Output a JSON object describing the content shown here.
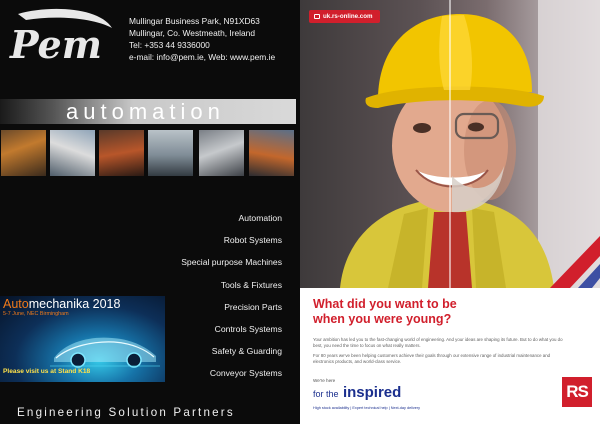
{
  "pem": {
    "logo_text": "Pem",
    "contact": {
      "address_line1": "Mullingar Business Park, N91XD63",
      "address_line2": "Mullingar, Co. Westmeath, Ireland",
      "tel": "Tel: +353 44 9336000",
      "email_web": "e-mail: info@pem.ie, Web: www.pem.ie"
    },
    "banner": "automation",
    "services": [
      "Automation",
      "Robot Systems",
      "Special purpose Machines",
      "Tools & Fixtures",
      "Precision Parts",
      "Controls Systems",
      "Safety & Guarding",
      "Conveyor Systems"
    ],
    "ad": {
      "title_highlight": "Auto",
      "title_rest": "mechanika 2018",
      "dates": "5-7 June, NEC Birmingham",
      "stand": "Please visit us at Stand K18"
    },
    "slogan": "Engineering Solution Partners"
  },
  "rs": {
    "url": "uk.rs-online.com",
    "headline_line1": "What did you want to be",
    "headline_line2": "when you were young?",
    "body_para1": "Your ambition has led you to the fast-changing world of engineering. And your ideas are shaping its future. But to do what you do best, you need the time to focus on what really matters.",
    "body_para2": "For 80 years we've been helping customers achieve their goals through our extensive range of industrial maintenance and electronics products, and world-class service.",
    "here_text": "We're here",
    "for_the": "for the",
    "inspired": "inspired",
    "footer": "High stock availability | Expert technical help | Next-day delivery",
    "logo_text": "RS"
  },
  "colors": {
    "pem_background": "#0b0b0b",
    "rs_red": "#d11f2c",
    "rs_blue": "#1b2f8e",
    "automechanika_orange": "#f07a1a",
    "stand_yellow": "#ffe14a"
  }
}
